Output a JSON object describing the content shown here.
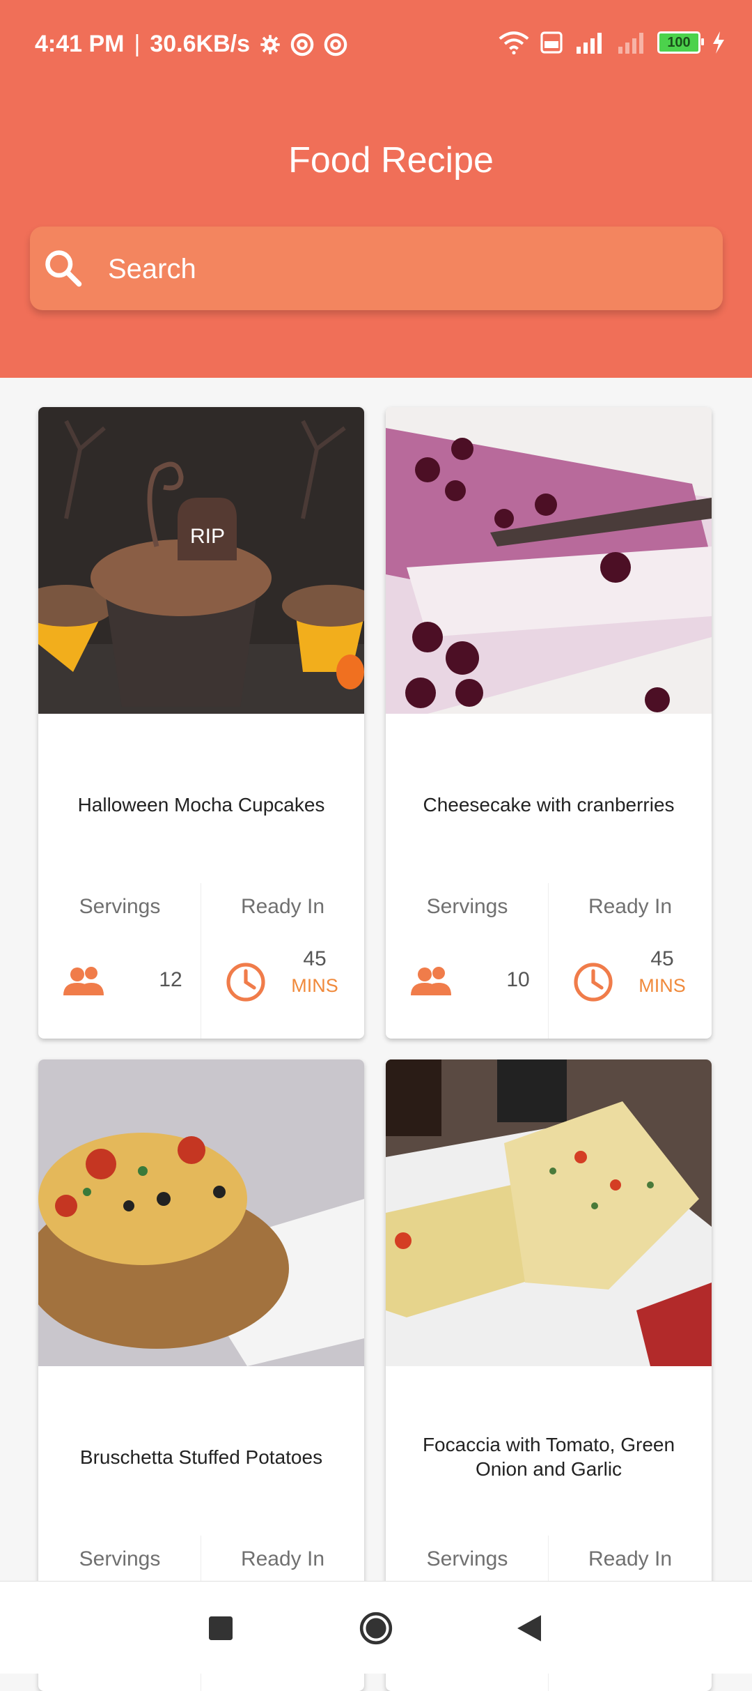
{
  "status": {
    "time": "4:41 PM",
    "speed": "30.6KB/s",
    "battery": "100"
  },
  "app": {
    "title": "Food Recipe"
  },
  "search": {
    "placeholder": "Search"
  },
  "labels": {
    "servings": "Servings",
    "ready_in": "Ready In",
    "mins": "MINS"
  },
  "recipes": [
    {
      "name": "Halloween Mocha Cupcakes",
      "servings": "12",
      "ready_in": "45"
    },
    {
      "name": "Cheesecake with cranberries",
      "servings": "10",
      "ready_in": "45"
    },
    {
      "name": "Bruschetta Stuffed Potatoes",
      "servings": "",
      "ready_in": ""
    },
    {
      "name": "Focaccia with Tomato, Green Onion and Garlic",
      "servings": "",
      "ready_in": ""
    }
  ],
  "colors": {
    "header": "#f06f58",
    "search": "#f3855f",
    "accent": "#f08a3c"
  },
  "icons": [
    "gear-icon",
    "wifi-icon",
    "signal-icon",
    "battery-icon",
    "search-icon",
    "people-icon",
    "clock-icon",
    "recents-icon",
    "home-icon",
    "back-icon"
  ]
}
